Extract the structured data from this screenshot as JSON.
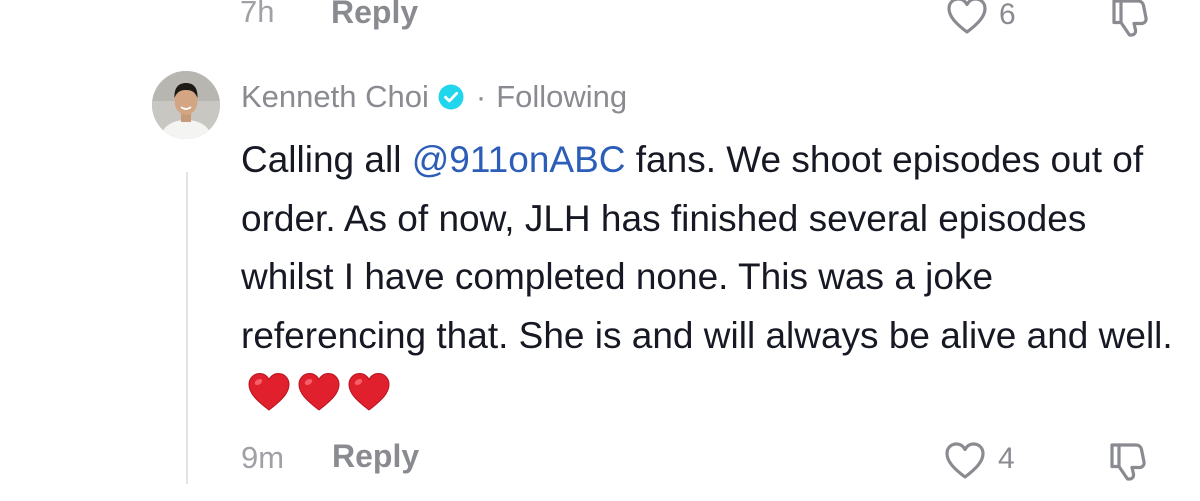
{
  "previous_comment": {
    "time": "7h",
    "reply_label": "Reply",
    "like_count": "6",
    "like_icon": "heart-outline-icon",
    "dislike_icon": "thumbs-down-icon"
  },
  "comment": {
    "username": "Kenneth Choi",
    "verified_icon": "verified-badge-icon",
    "separator": "·",
    "follow_status": "Following",
    "text_before_mention": "Calling all ",
    "mention": "@911onABC",
    "text_after_mention": " fans. We shoot episodes out of order. As of now, JLH has finished several episodes whilst I have completed none. This was a joke referencing that. She is and will always be alive and well.",
    "emojis": [
      "red-heart",
      "red-heart",
      "red-heart"
    ],
    "time": "9m",
    "reply_label": "Reply",
    "like_count": "4",
    "like_icon": "heart-outline-icon",
    "dislike_icon": "thumbs-down-icon"
  },
  "colors": {
    "mention": "#2b5db9",
    "verified_badge": "#20d5ec",
    "heart_emoji": "#e0202c",
    "muted_text": "#8a8b91",
    "primary_text": "#161823"
  }
}
